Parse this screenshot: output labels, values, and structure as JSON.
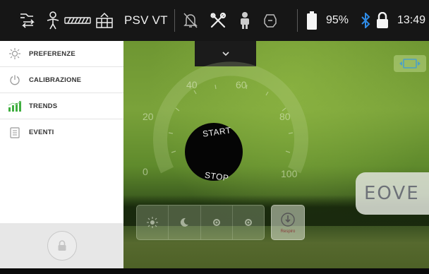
{
  "statusbar": {
    "mode": "PSV VT",
    "battery": "95%",
    "time": "13:49",
    "icons": [
      "circuit-config-icon",
      "patient-child-icon",
      "humidifier-icon",
      "alarm-muted-icon",
      "tools-icon",
      "patient-icon",
      "mask-icon",
      "battery-icon",
      "bluetooth-icon",
      "lock-icon"
    ]
  },
  "menu": {
    "items": [
      {
        "label": "PREFERENZE",
        "icon": "settings-sun-icon"
      },
      {
        "label": "CALIBRAZIONE",
        "icon": "power-icon"
      },
      {
        "label": "TRENDS",
        "icon": "trends-icon"
      },
      {
        "label": "EVENTI",
        "icon": "events-icon"
      }
    ]
  },
  "dial": {
    "ticks": [
      "0",
      "20",
      "40",
      "60",
      "80",
      "100"
    ],
    "start_label": "START",
    "stop_label": "STOP"
  },
  "logo": {
    "text": "EOVE"
  },
  "buttons": {
    "respiro_label": "Respiro"
  },
  "colors": {
    "statusbar_bg": "#161616",
    "bluetooth": "#2f8be6",
    "trends_green": "#3fae3f",
    "menu_bg": "#ffffff"
  }
}
